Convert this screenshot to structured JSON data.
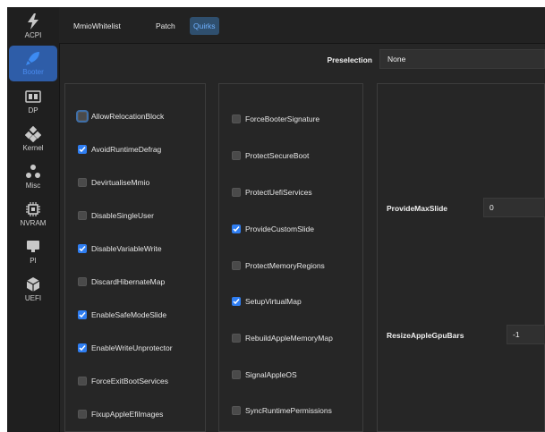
{
  "sidebar": {
    "items": [
      {
        "label": "ACPI",
        "icon": "lightning-icon",
        "active": false
      },
      {
        "label": "Booter",
        "icon": "rocket-icon",
        "active": true
      },
      {
        "label": "DP",
        "icon": "device-properties-icon",
        "active": false
      },
      {
        "label": "Kernel",
        "icon": "kernel-icon",
        "active": false
      },
      {
        "label": "Misc",
        "icon": "misc-icon",
        "active": false
      },
      {
        "label": "NVRAM",
        "icon": "chip-icon",
        "active": false
      },
      {
        "label": "PI",
        "icon": "monitor-icon",
        "active": false
      },
      {
        "label": "UEFI",
        "icon": "cube-icon",
        "active": false
      }
    ]
  },
  "tabs": [
    {
      "label": "MmioWhitelist",
      "active": false
    },
    {
      "label": "Patch",
      "active": false
    },
    {
      "label": "Quirks",
      "active": true
    }
  ],
  "preselection": {
    "label": "Preselection",
    "value": "None"
  },
  "quirks_col1": [
    {
      "label": "AllowRelocationBlock",
      "checked": false,
      "focused": true
    },
    {
      "label": "AvoidRuntimeDefrag",
      "checked": true
    },
    {
      "label": "DevirtualiseMmio",
      "checked": false
    },
    {
      "label": "DisableSingleUser",
      "checked": false
    },
    {
      "label": "DisableVariableWrite",
      "checked": true
    },
    {
      "label": "DiscardHibernateMap",
      "checked": false
    },
    {
      "label": "EnableSafeModeSlide",
      "checked": true
    },
    {
      "label": "EnableWriteUnprotector",
      "checked": true
    },
    {
      "label": "ForceExitBootServices",
      "checked": false
    },
    {
      "label": "FixupAppleEfiImages",
      "checked": false
    }
  ],
  "quirks_col2": [
    {
      "label": "ForceBooterSignature",
      "checked": false
    },
    {
      "label": "ProtectSecureBoot",
      "checked": false
    },
    {
      "label": "ProtectUefiServices",
      "checked": false
    },
    {
      "label": "ProvideCustomSlide",
      "checked": true
    },
    {
      "label": "ProtectMemoryRegions",
      "checked": false
    },
    {
      "label": "SetupVirtualMap",
      "checked": true
    },
    {
      "label": "RebuildAppleMemoryMap",
      "checked": false
    },
    {
      "label": "SignalAppleOS",
      "checked": false
    },
    {
      "label": "SyncRuntimePermissions",
      "checked": false
    }
  ],
  "fields": {
    "provide_max_slide": {
      "label": "ProvideMaxSlide",
      "value": "0"
    },
    "resize_apple_gpu_bars": {
      "label": "ResizeAppleGpuBars",
      "value": "-1"
    }
  }
}
